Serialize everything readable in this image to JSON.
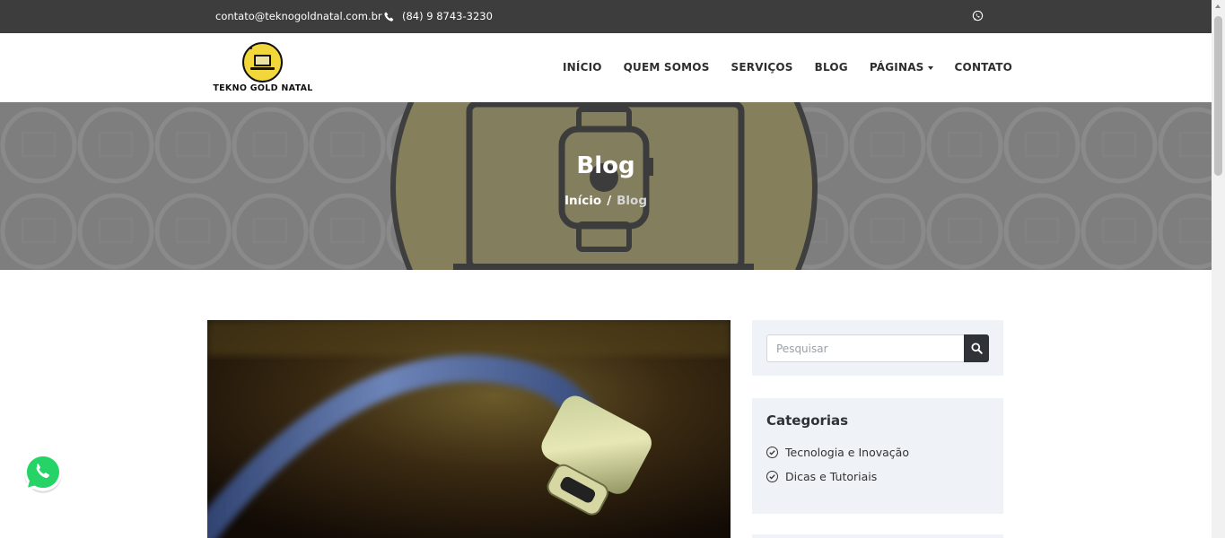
{
  "topbar": {
    "email": "contato@teknogoldnatal.com.br",
    "phone": "(84) 9 8743-3230",
    "phone_icon": "phone-icon",
    "social_icon": "whatsapp-icon"
  },
  "brand": {
    "name": "TEKNO GOLD NATAL",
    "accent": "#f2d73a"
  },
  "nav": {
    "items": [
      {
        "label": "INÍCIO"
      },
      {
        "label": "QUEM SOMOS"
      },
      {
        "label": "SERVIÇOS"
      },
      {
        "label": "BLOG"
      },
      {
        "label": "PÁGINAS",
        "dropdown": true
      },
      {
        "label": "CONTATO"
      }
    ]
  },
  "hero": {
    "title": "Blog",
    "breadcrumb": {
      "home": "Início",
      "separator": "/",
      "current": "Blog"
    }
  },
  "sidebar": {
    "search": {
      "placeholder": "Pesquisar",
      "value": "",
      "icon": "search-icon"
    },
    "categories": {
      "title": "Categorias",
      "items": [
        {
          "label": "Tecnologia e Inovação"
        },
        {
          "label": "Dicas e Tutoriais"
        }
      ]
    }
  },
  "colors": {
    "topbar_bg": "#3d3d3d",
    "hero_overlay": "#7a7a7a",
    "sidebar_bg": "#eff2f6",
    "whatsapp": "#25d366",
    "search_button": "#2f3338"
  }
}
